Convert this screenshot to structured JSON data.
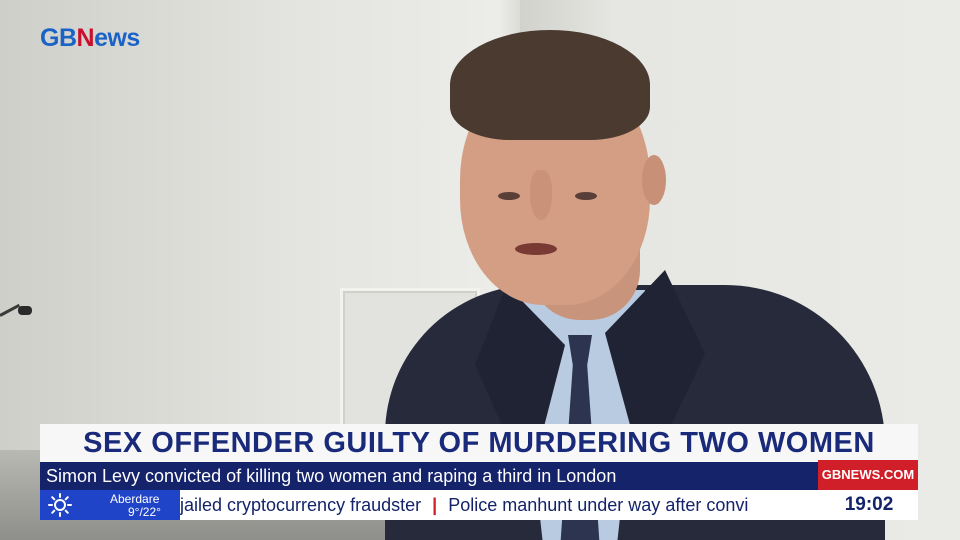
{
  "logo": {
    "part1": "GB",
    "part2": "N",
    "part3": "ews"
  },
  "lower_third": {
    "headline": "SEX OFFENDER GUILTY OF MURDERING TWO WOMEN",
    "subtitle": "Simon Levy convicted of killing two women and raping a third in London",
    "website": "GBNEWS.COM"
  },
  "weather": {
    "location": "Aberdare",
    "temps": "9°/22°",
    "icon": "sun-icon"
  },
  "ticker": {
    "item1": "jailed cryptocurrency fraudster",
    "separator": "|",
    "item2": "Police manhunt under way after convi"
  },
  "clock": {
    "time": "19:02"
  },
  "colors": {
    "navy": "#14236a",
    "brand_blue": "#1b62c7",
    "red": "#d11f2a",
    "headline_text": "#1a2a7a"
  }
}
